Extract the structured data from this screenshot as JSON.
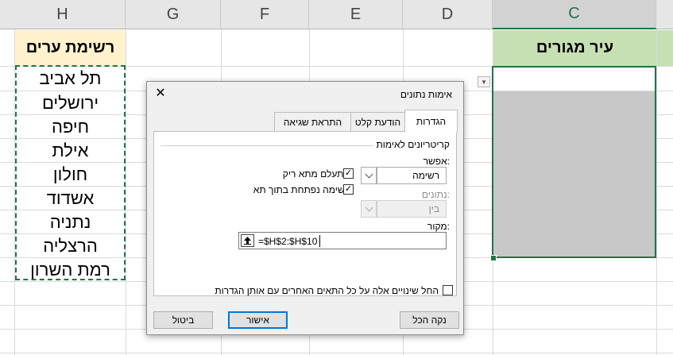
{
  "columns": [
    "H",
    "G",
    "F",
    "E",
    "D",
    "C"
  ],
  "sheet": {
    "list_header": "רשימת ערים",
    "target_header": "עיר מגורים",
    "cities": [
      "תל אביב",
      "ירושלים",
      "חיפה",
      "אילת",
      "חולון",
      "אשדוד",
      "נתניה",
      "הרצליה",
      "רמת השרון"
    ]
  },
  "dialog": {
    "title": "אימות נתונים",
    "tabs": [
      "הגדרות",
      "הודעת קלט",
      "התראת שגיאה"
    ],
    "criteria_label": "קריטריונים לאימות",
    "allow_label": "אפשר:",
    "allow_value": "רשימה",
    "ignore_blank_label": "התעלם מתא ריק",
    "ignore_blank_checked": true,
    "in_cell_dropdown_label": "רשימה נפתחת בתוך תא",
    "in_cell_dropdown_checked": true,
    "data_label": "נתונים:",
    "data_value": "בין",
    "source_label": "מקור:",
    "source_value": "=$H$2:$H$10",
    "apply_all_label": "החל שינויים אלה על כל התאים האחרים עם אותן הגדרות",
    "apply_all_checked": false,
    "buttons": {
      "clear_all": "נקה הכל",
      "ok": "אישור",
      "cancel": "ביטול"
    }
  },
  "colors": {
    "accent": "#217346",
    "list_header_fill": "#fff2cc",
    "target_header_fill": "#c6e0b4",
    "target_cells_fill": "#c8c8c8",
    "default_button_border": "#0078d7"
  }
}
